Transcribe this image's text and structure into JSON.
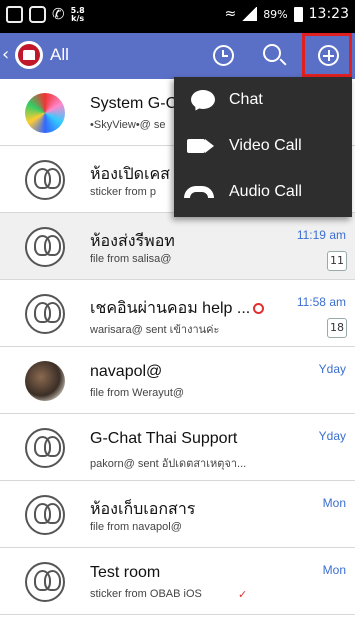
{
  "statusbar": {
    "speed_value": "5.8",
    "speed_unit": "k/s",
    "battery": "89%",
    "time": "13:23"
  },
  "appbar": {
    "title": "All"
  },
  "menu": {
    "items": [
      {
        "label": "Chat",
        "icon": "chat-bubble-icon"
      },
      {
        "label": "Video Call",
        "icon": "video-camera-icon"
      },
      {
        "label": "Audio Call",
        "icon": "phone-handset-icon"
      }
    ]
  },
  "conversations": [
    {
      "name": "System G-C",
      "sub": "•SkyView•@ se",
      "time": "",
      "badge": ""
    },
    {
      "name": "ห้องเปิดเคส",
      "sub": "sticker from p",
      "time": "",
      "badge": ""
    },
    {
      "name": "ห้องส่งรีพอท",
      "sub": "file from salisa@",
      "time": "11:19 am",
      "badge": "11"
    },
    {
      "name": "เชคอินผ่านคอม help ...",
      "sub": "warisara@ sent เข้างานค่ะ",
      "time": "11:58 am",
      "badge": "18"
    },
    {
      "name": "navapol@",
      "sub": "file from Werayut@",
      "time": "Yday",
      "badge": ""
    },
    {
      "name": "G-Chat Thai Support",
      "sub": "pakorn@ sent อัปเดตสาเหตุจา...",
      "time": "Yday",
      "badge": ""
    },
    {
      "name": "ห้องเก็บเอกสาร",
      "sub": "file from navapol@",
      "time": "Mon",
      "badge": ""
    },
    {
      "name": "Test room",
      "sub": "sticker from OBAB iOS",
      "time": "Mon",
      "badge": ""
    }
  ],
  "colors": {
    "appbar": "#5a6fc6",
    "accent_time": "#3b6fd0",
    "menu_bg": "#2e2e2e",
    "highlight_box": "#e02020"
  }
}
